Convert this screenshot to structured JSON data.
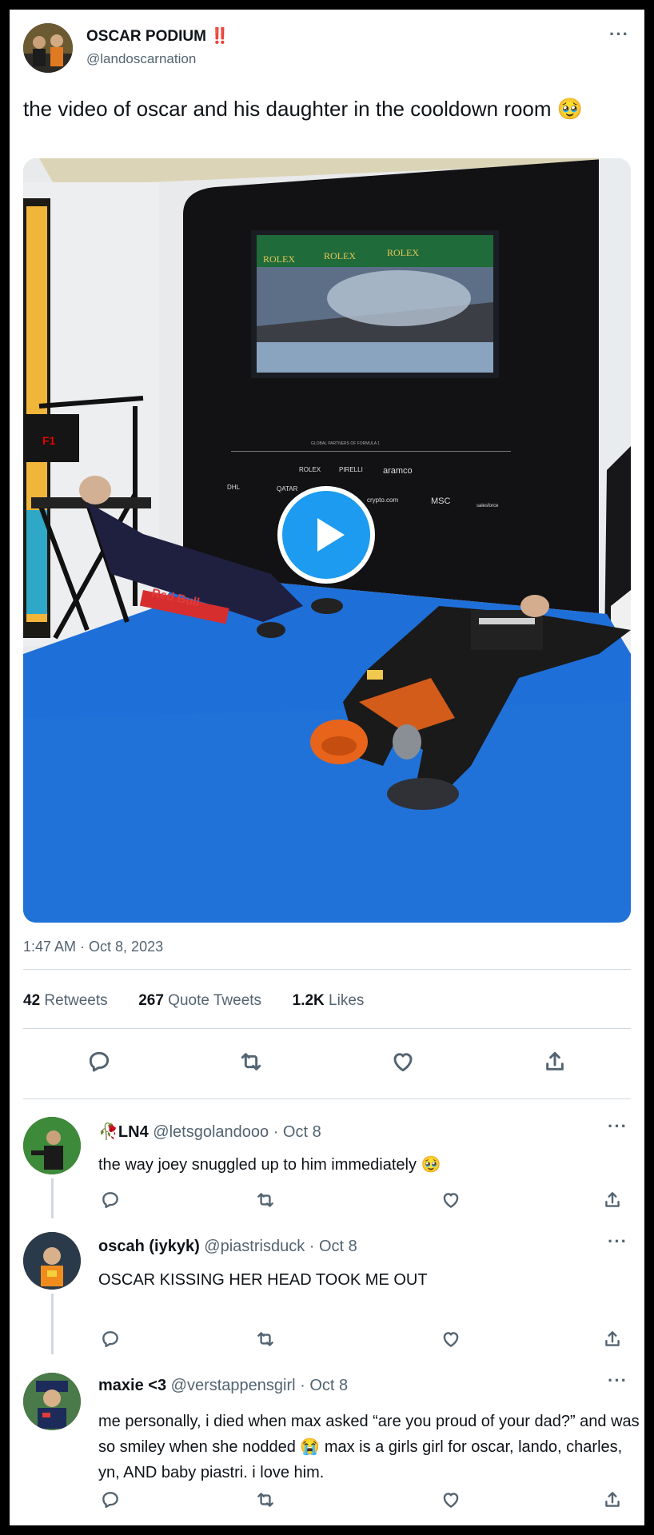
{
  "tweet": {
    "author_name": "OSCAR PODIUM",
    "author_emoji": "‼️",
    "author_handle": "@landoscarnation",
    "text": "the video of oscar and his daughter in the cooldown room 🥹",
    "video": {
      "screen_banners": [
        "ROLEX",
        "ROLEX",
        "ROLEX"
      ],
      "partner_heading": "GLOBAL PARTNERS OF FORMULA 1",
      "sponsors_row1": [
        "ROLEX",
        "PIRELLI",
        "aramco"
      ],
      "sponsors_row2": [
        "DHL",
        "QATAR",
        "crypto.com",
        "MSC",
        "salesforce"
      ],
      "chair_text": "F1",
      "suit_text": "Red Bull"
    },
    "timestamp": "1:47 AM · Oct 8, 2023",
    "stats": {
      "retweets_count": "42",
      "retweets_label": "Retweets",
      "quotes_count": "267",
      "quotes_label": "Quote Tweets",
      "likes_count": "1.2K",
      "likes_label": "Likes"
    }
  },
  "replies": [
    {
      "name": "LN4",
      "name_emoji": "🥀",
      "handle": "@letsgolandooo",
      "date": "· Oct 8",
      "text": "the way joey snuggled up to him immediately 🥹"
    },
    {
      "name": "oscah (iykyk)",
      "handle": "@piastrisduck",
      "date": "· Oct 8",
      "text": "OSCAR KISSING HER HEAD TOOK ME OUT"
    },
    {
      "name": "maxie <3",
      "handle": "@verstappensgirl",
      "date": "· Oct 8",
      "text": "me personally, i died when max asked “are you proud of your dad?” and was so smiley when she nodded 😭 max is a girls girl for oscar, lando, charles, yn, AND baby piastri. i love him."
    }
  ],
  "icons": [
    "more-icon",
    "reply-icon",
    "retweet-icon",
    "like-icon",
    "share-icon",
    "play-icon"
  ],
  "colors": {
    "text": "#0f1419",
    "secondary": "#536471",
    "accent": "#1d9bf0",
    "floor": "#1e6fd8"
  }
}
